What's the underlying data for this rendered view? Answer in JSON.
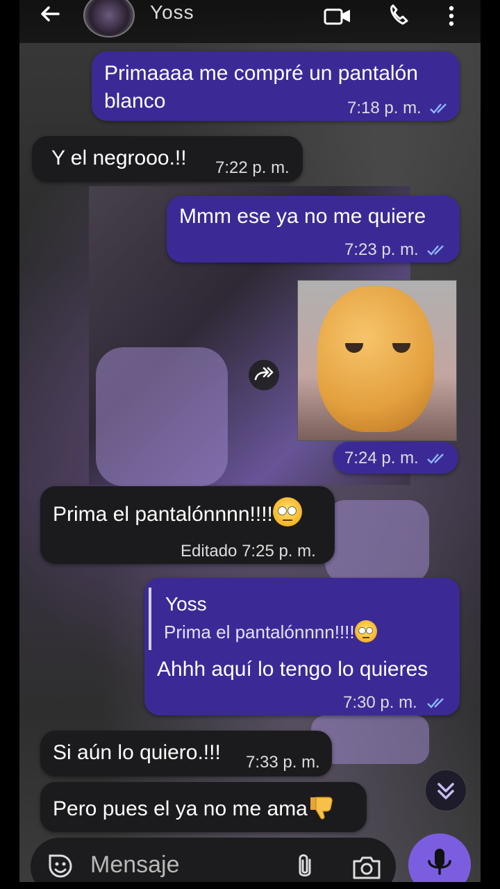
{
  "header": {
    "contact_name": "Yoss",
    "icons": [
      "back-arrow-icon",
      "avatar",
      "video-call-icon",
      "phone-call-icon",
      "more-vert-icon"
    ]
  },
  "messages": [
    {
      "direction": "out",
      "text_line1": "Primaaaa me compré un pantalón",
      "text_line2": "blanco",
      "time": "7:18 p. m."
    },
    {
      "direction": "in",
      "text": "Y el negrooo.!!",
      "time": "7:22 p. m."
    },
    {
      "direction": "out",
      "text": "Mmm ese ya no me quiere",
      "time": "7:23 p. m."
    },
    {
      "direction": "out",
      "type": "sticker",
      "time": "7:24 p. m."
    },
    {
      "direction": "in",
      "text": "Prima el pantalónnnn!!!!",
      "edited_label": "Editado",
      "time": "7:25 p. m."
    },
    {
      "direction": "out",
      "reply_author": "Yoss",
      "reply_text": "Prima el pantalónnnn!!!!",
      "text": "Ahhh aquí lo tengo lo quieres",
      "time": "7:30 p. m."
    },
    {
      "direction": "in",
      "text": "Si aún lo quiero.!!!",
      "time": "7:33 p. m."
    },
    {
      "direction": "in",
      "text": "Pero pues el ya no me ama"
    }
  ],
  "composer": {
    "placeholder": "Mensaje"
  },
  "colors": {
    "outgoing": "#3b2a96",
    "incoming": "#1b1b1d",
    "mic_button": "#7b5ee0",
    "read_ticks": "#8fb7ff"
  }
}
